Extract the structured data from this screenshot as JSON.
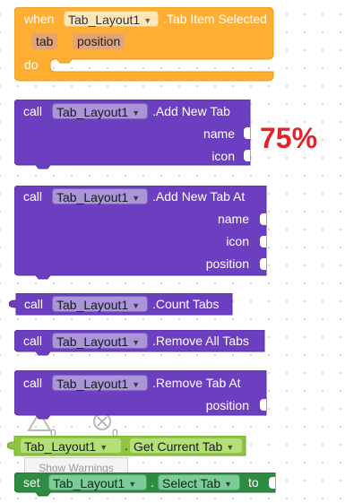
{
  "event_block": {
    "keyword_when": "when",
    "component": "Tab_Layout1",
    "event_name": ".Tab Item Selected",
    "param_tab": "tab",
    "param_position": "position",
    "keyword_do": "do",
    "color": "#fdae33"
  },
  "add_new_tab": {
    "keyword": "call",
    "component": "Tab_Layout1",
    "method": ".Add New Tab",
    "arg_name": "name",
    "arg_icon": "icon",
    "color": "#6c3fc1"
  },
  "progress_badge": "75%",
  "add_new_tab_at": {
    "keyword": "call",
    "component": "Tab_Layout1",
    "method": ".Add New Tab At",
    "arg_name": "name",
    "arg_icon": "icon",
    "arg_position": "position"
  },
  "count_tabs": {
    "keyword": "call",
    "component": "Tab_Layout1",
    "method": ".Count Tabs"
  },
  "remove_all_tabs": {
    "keyword": "call",
    "component": "Tab_Layout1",
    "method": ".Remove All Tabs"
  },
  "remove_tab_at": {
    "keyword": "call",
    "component": "Tab_Layout1",
    "method": ".Remove Tab At",
    "arg_position": "position"
  },
  "get_current_tab": {
    "component": "Tab_Layout1",
    "dot": ".",
    "property": "Get Current Tab",
    "color": "#8cc63f"
  },
  "warnings": {
    "warn_count": "0",
    "error_count": "0",
    "show_warnings_label": "Show Warnings"
  },
  "set_select_tab": {
    "keyword_set": "set",
    "component": "Tab_Layout1",
    "dot": ".",
    "property": "Select Tab",
    "keyword_to": "to",
    "color": "#2e8b42"
  }
}
